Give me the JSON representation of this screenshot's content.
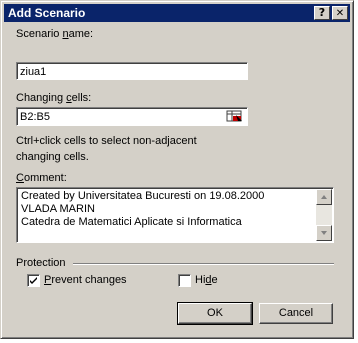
{
  "dialog": {
    "title": "Add Scenario",
    "help_glyph": "?",
    "close_glyph": "✕"
  },
  "scenario_name": {
    "label_pre": "Scenario ",
    "label_key": "n",
    "label_post": "ame:",
    "value": "ziua1"
  },
  "changing_cells": {
    "label_pre": "Changing ",
    "label_key": "c",
    "label_post": "ells:",
    "value": "B2:B5"
  },
  "hint": {
    "line1": "Ctrl+click cells to select non-adjacent",
    "line2": "changing cells."
  },
  "comment": {
    "label_key": "C",
    "label_post": "omment:",
    "lines": [
      "Created by Universitatea Bucuresti on 19.08.2000",
      "VLADA MARIN",
      "Catedra de Matematici Aplicate si Informatica"
    ]
  },
  "protection": {
    "title": "Protection",
    "prevent_key": "P",
    "prevent_post": "revent changes",
    "prevent_checked": true,
    "hide_pre": "Hi",
    "hide_key": "d",
    "hide_post": "e",
    "hide_checked": false
  },
  "buttons": {
    "ok": "OK",
    "cancel": "Cancel"
  }
}
